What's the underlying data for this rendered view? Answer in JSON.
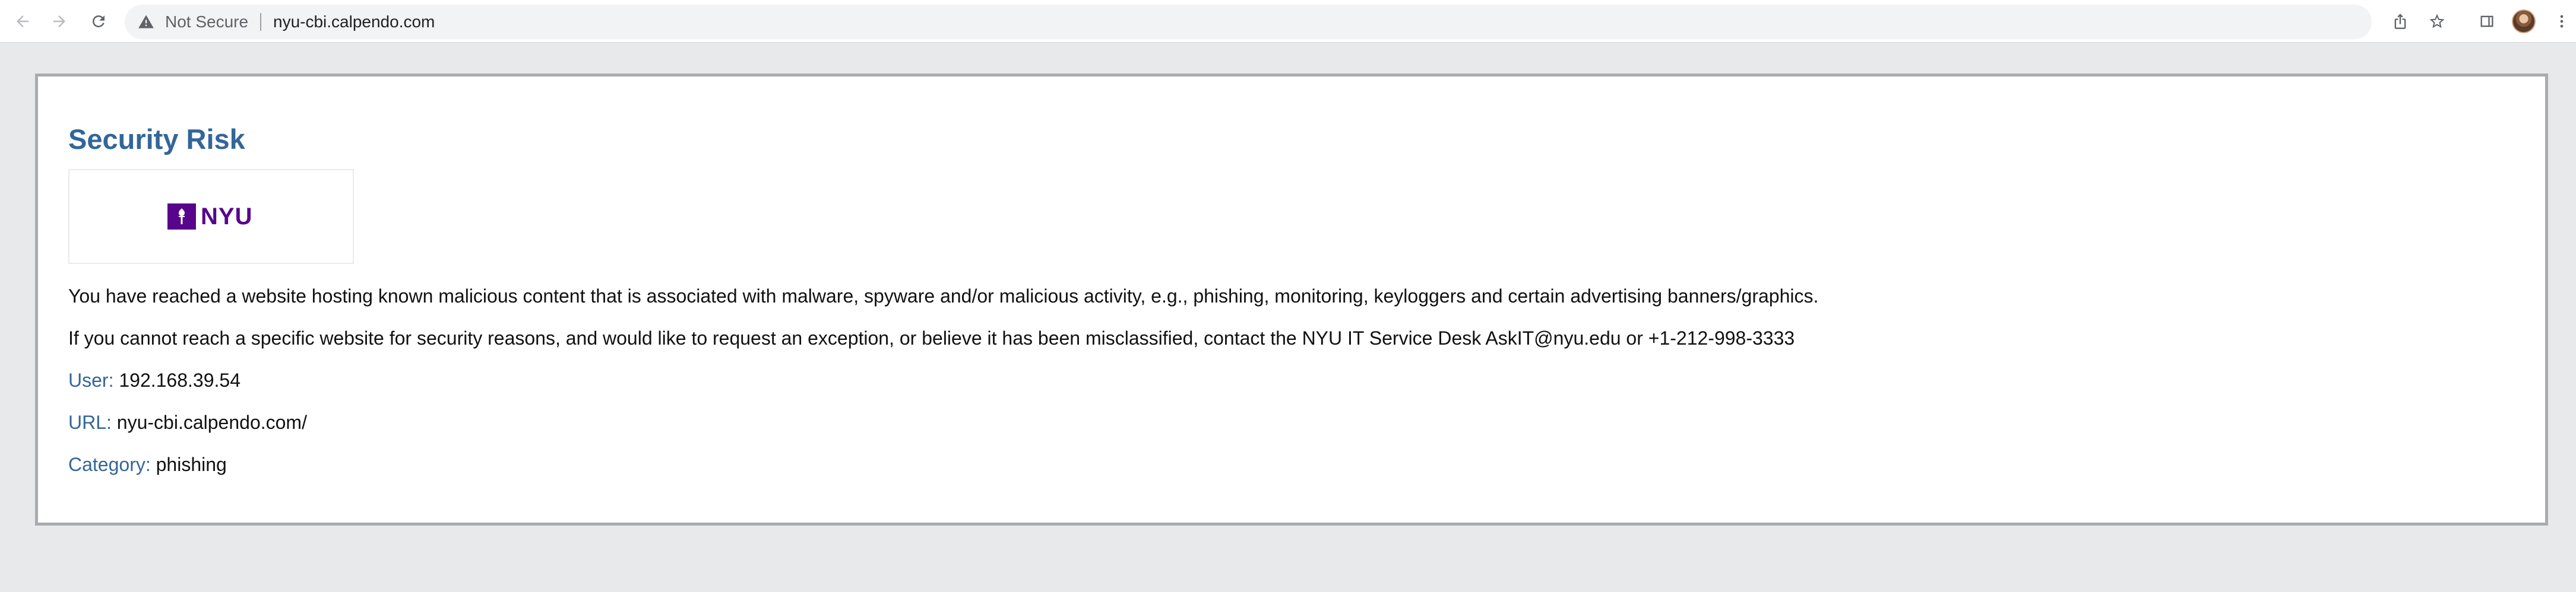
{
  "browser": {
    "security_label": "Not Secure",
    "url": "nyu-cbi.calpendo.com",
    "icons": {
      "back": "back-arrow-icon",
      "forward": "forward-arrow-icon",
      "reload": "reload-icon",
      "warning": "warning-triangle-icon",
      "share": "share-icon",
      "bookmark": "star-icon",
      "side_panel": "side-panel-icon",
      "menu": "kebab-menu-icon"
    }
  },
  "page": {
    "title": "Security Risk",
    "logo_text": "NYU",
    "message": "You have reached a website hosting known malicious content that is associated with malware, spyware and/or malicious activity, e.g., phishing, monitoring, keyloggers and certain advertising banners/graphics.",
    "contact": "If you cannot reach a specific website for security reasons, and would like to request an exception, or believe it has been misclassified, contact the NYU IT Service Desk AskIT@nyu.edu or +1-212-998-3333",
    "fields": [
      {
        "label": "User:",
        "value": "192.168.39.54"
      },
      {
        "label": "URL:",
        "value": "nyu-cbi.calpendo.com/"
      },
      {
        "label": "Category:",
        "value": "phishing"
      }
    ]
  },
  "colors": {
    "title": "#336699",
    "label": "#336699",
    "brand": "#57068c",
    "page_bg": "#e8e9eb",
    "panel_border": "#a9abae"
  }
}
